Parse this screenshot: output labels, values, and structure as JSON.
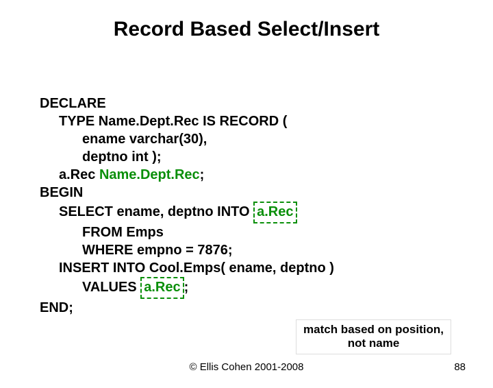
{
  "title": "Record Based Select/Insert",
  "code": {
    "declare": "DECLARE",
    "typedef_open": "TYPE Name.Dept.Rec IS RECORD (",
    "field1": "ename varchar(30),",
    "field2": "deptno int );",
    "recdecl_pre": "a.Rec ",
    "recdecl_type": "Name.Dept.Rec",
    "recdecl_semi": ";",
    "begin": "BEGIN",
    "select_pre": "SELECT ename, deptno INTO ",
    "select_rec": "a.Rec",
    "select_line2": "FROM Emps",
    "select_line3": "WHERE empno = 7876;",
    "insert_line1": "INSERT INTO Cool.Emps( ename, deptno )",
    "insert_pre": "VALUES ",
    "insert_rec": "a.Rec",
    "insert_semi": ";",
    "end": "END;"
  },
  "callout": "match based on position, not name",
  "footer": "© Ellis Cohen 2001-2008",
  "page": "88"
}
